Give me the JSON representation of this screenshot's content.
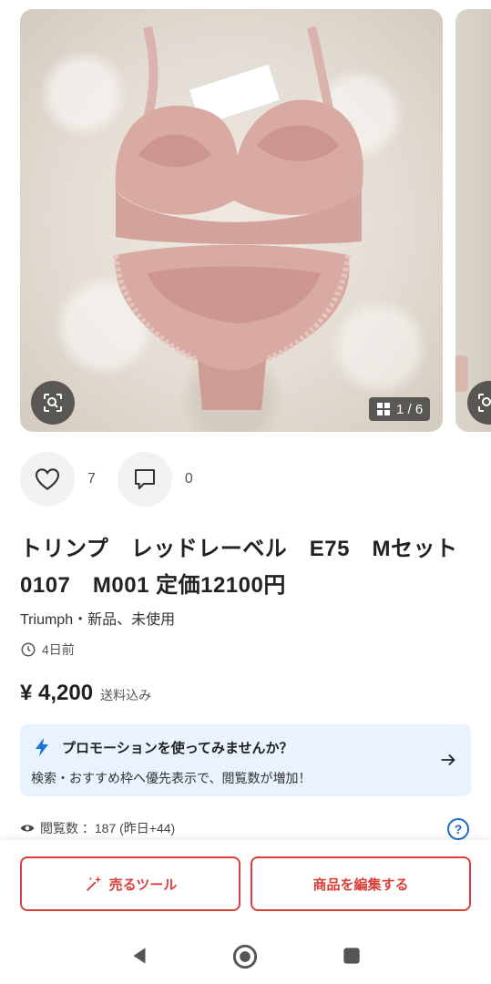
{
  "carousel": {
    "counter": "1 / 6",
    "icons": {
      "zoom": "image-search-icon",
      "grid": "grid-icon"
    }
  },
  "actions": {
    "likes": "7",
    "comments": "0"
  },
  "product": {
    "title": "トリンプ　レッドレーベル　E75　Mセット 0107　M001 定価12100円",
    "brand_condition": "Triumph・新品、未使用",
    "posted": "4日前",
    "price": "¥ 4,200",
    "shipping": "送料込み"
  },
  "promo": {
    "heading": "プロモーションを使ってみませんか？",
    "sub": "検索・おすすめ枠へ優先表示で、閲覧数が増加！"
  },
  "stats": {
    "views": "閲覧数 ：187 (昨日+44)",
    "help": "?"
  },
  "buttons": {
    "sell_tool": "売るツール",
    "edit_item": "商品を編集する"
  },
  "colors": {
    "accent": "#d9403a",
    "promo_bg": "#e8f3fd",
    "link_blue": "#1a6cc4"
  }
}
